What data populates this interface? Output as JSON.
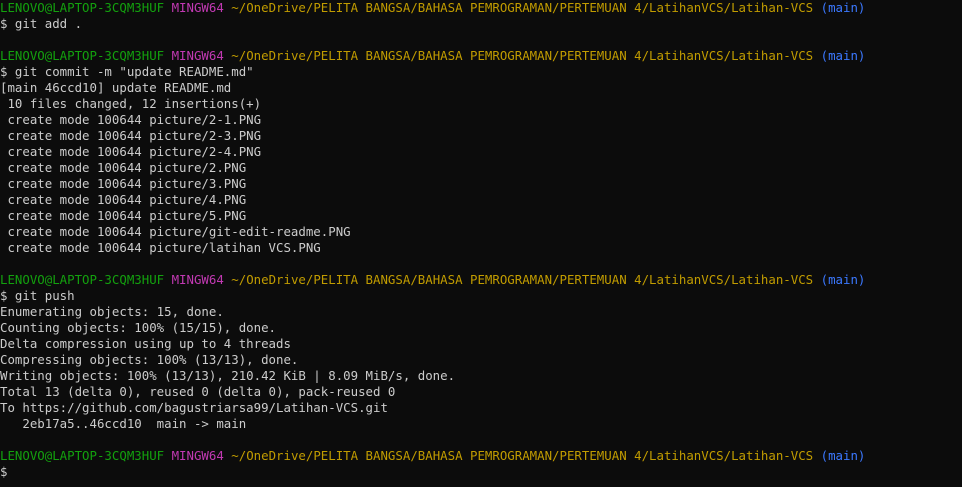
{
  "prompt": {
    "user_host": "LENOVO@LAPTOP-3CQM3HUF",
    "system": "MINGW64",
    "path": "~/OneDrive/PELITA BANGSA/BAHASA PEMROGRAMAN/PERTEMUAN 4/LatihanVCS/Latihan-VCS",
    "branch": "(main)",
    "symbol": "$"
  },
  "session": {
    "cmd1": "$ git add .",
    "cmd2": "$ git commit -m \"update README.md\"",
    "commit_output": [
      "[main 46ccd10] update README.md",
      " 10 files changed, 12 insertions(+)",
      " create mode 100644 picture/2-1.PNG",
      " create mode 100644 picture/2-3.PNG",
      " create mode 100644 picture/2-4.PNG",
      " create mode 100644 picture/2.PNG",
      " create mode 100644 picture/3.PNG",
      " create mode 100644 picture/4.PNG",
      " create mode 100644 picture/5.PNG",
      " create mode 100644 picture/git-edit-readme.PNG",
      " create mode 100644 picture/latihan VCS.PNG"
    ],
    "cmd3": "$ git push",
    "push_output": [
      "Enumerating objects: 15, done.",
      "Counting objects: 100% (15/15), done.",
      "Delta compression using up to 4 threads",
      "Compressing objects: 100% (13/13), done.",
      "Writing objects: 100% (13/13), 210.42 KiB | 8.09 MiB/s, done.",
      "Total 13 (delta 0), reused 0 (delta 0), pack-reused 0",
      "To https://github.com/bagustriarsa99/Latihan-VCS.git",
      "   2eb17a5..46ccd10  main -> main"
    ],
    "final_prompt": "$"
  },
  "colors": {
    "background": "#0c0c0c",
    "text": "#cccccc",
    "user_host": "#13a10e",
    "system": "#c239b3",
    "path": "#c19c00",
    "branch": "#3b78ff"
  }
}
